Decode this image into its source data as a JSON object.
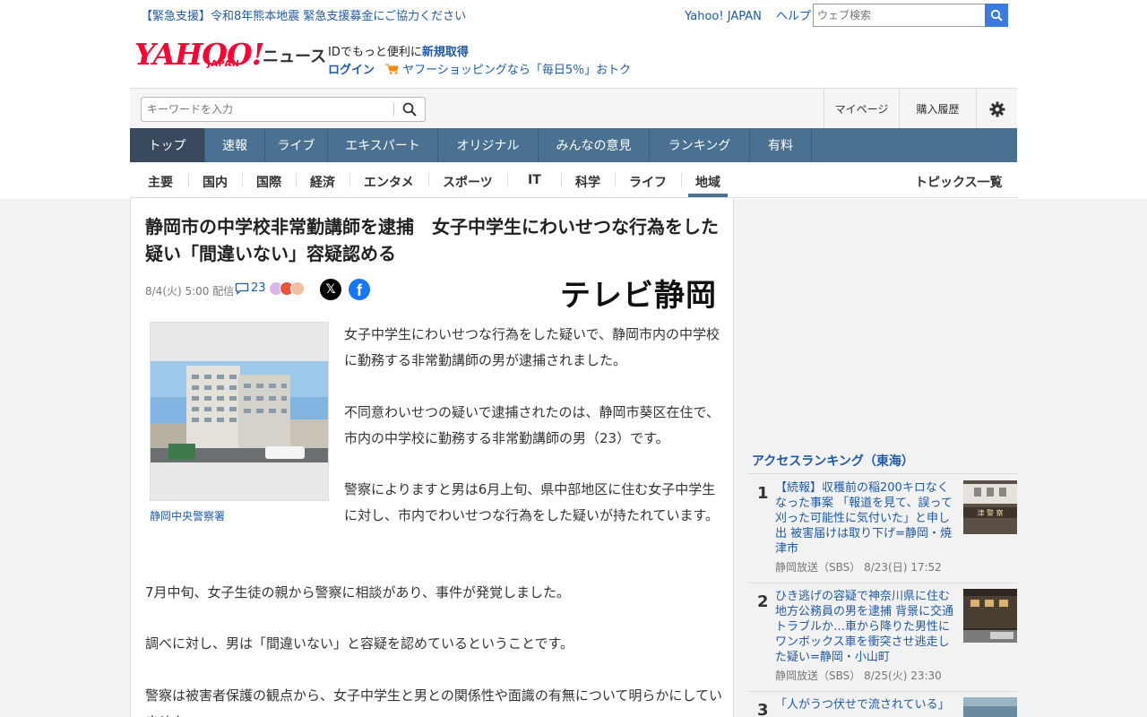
{
  "topbar": {
    "alert": "【緊急支援】令和8年熊本地震 緊急支援募金にご協力ください",
    "yahoo_japan": "Yahoo! JAPAN",
    "help": "ヘルプ",
    "web_search_placeholder": "ウェブ検索"
  },
  "header": {
    "logo_text": "YAHOO!",
    "logo_sub": "JAPAN",
    "news_label": "ニュース",
    "id_promo_prefix": "IDでもっと便利に",
    "id_promo_link": "新規取得",
    "login": "ログイン",
    "shopping_promo": "ヤフーショッピングなら「毎日5％」おトク"
  },
  "search": {
    "placeholder": "キーワードを入力",
    "mypage": "マイページ",
    "history": "購入履歴"
  },
  "main_nav": [
    "トップ",
    "速報",
    "ライブ",
    "エキスパート",
    "オリジナル",
    "みんなの意見",
    "ランキング",
    "有料"
  ],
  "sub_nav": [
    "主要",
    "国内",
    "国際",
    "経済",
    "エンタメ",
    "スポーツ",
    "IT",
    "科学",
    "ライフ",
    "地域"
  ],
  "sub_nav_active": "地域",
  "topics_link": "トピックス一覧",
  "article": {
    "headline": "静岡市の中学校非常勤講師を逮捕　女子中学生にわいせつな行為をした疑い「間違いない」容疑認める",
    "date": "8/4(火) 5:00 配信",
    "comment_count": "23",
    "source": "テレビ静岡",
    "photo_caption": "静岡中央警察署",
    "paragraphs": [
      "女子中学生にわいせつな行為をした疑いで、静岡市内の中学校に勤務する非常勤講師の男が逮捕されました。",
      "不同意わいせつの疑いで逮捕されたのは、静岡市葵区在住で、市内の中学校に勤務する非常勤講師の男（23）です。",
      "警察によりますと男は6月上旬、県中部地区に住む女子中学生に対し、市内でわいせつな行為をした疑いが持たれています。",
      "7月中旬、女子生徒の親から警察に相談があり、事件が発覚しました。",
      "調べに対し、男は「間違いない」と容疑を認めているということです。",
      "警察は被害者保護の観点から、女子中学生と男との関係性や面識の有無について明らかにしていません。"
    ]
  },
  "ranking": {
    "title": "アクセスランキング（東海）",
    "items": [
      {
        "rank": "1",
        "title": "【続報】収穫前の稲200キロなくなった事案 「報道を見て、誤って刈った可能性に気付いた」と申し出 被害届けは取り下げ=静岡・焼津市",
        "source": "静岡放送（SBS） 8/23(日) 17:52"
      },
      {
        "rank": "2",
        "title": "ひき逃げの容疑で神奈川県に住む地方公務員の男を逮捕 背景に交通トラブルか…車から降りた男性にワンボックス車を衝突させ逃走した疑い=静岡・小山町",
        "source": "静岡放送（SBS） 8/25(火) 23:30"
      },
      {
        "rank": "3",
        "title": "「人がうつ伏せで流されている」",
        "source": ""
      }
    ]
  },
  "colors": {
    "accent_blue": "#1e5aa8",
    "nav_blue": "#4a7191",
    "yahoo_red": "#ff0033"
  }
}
